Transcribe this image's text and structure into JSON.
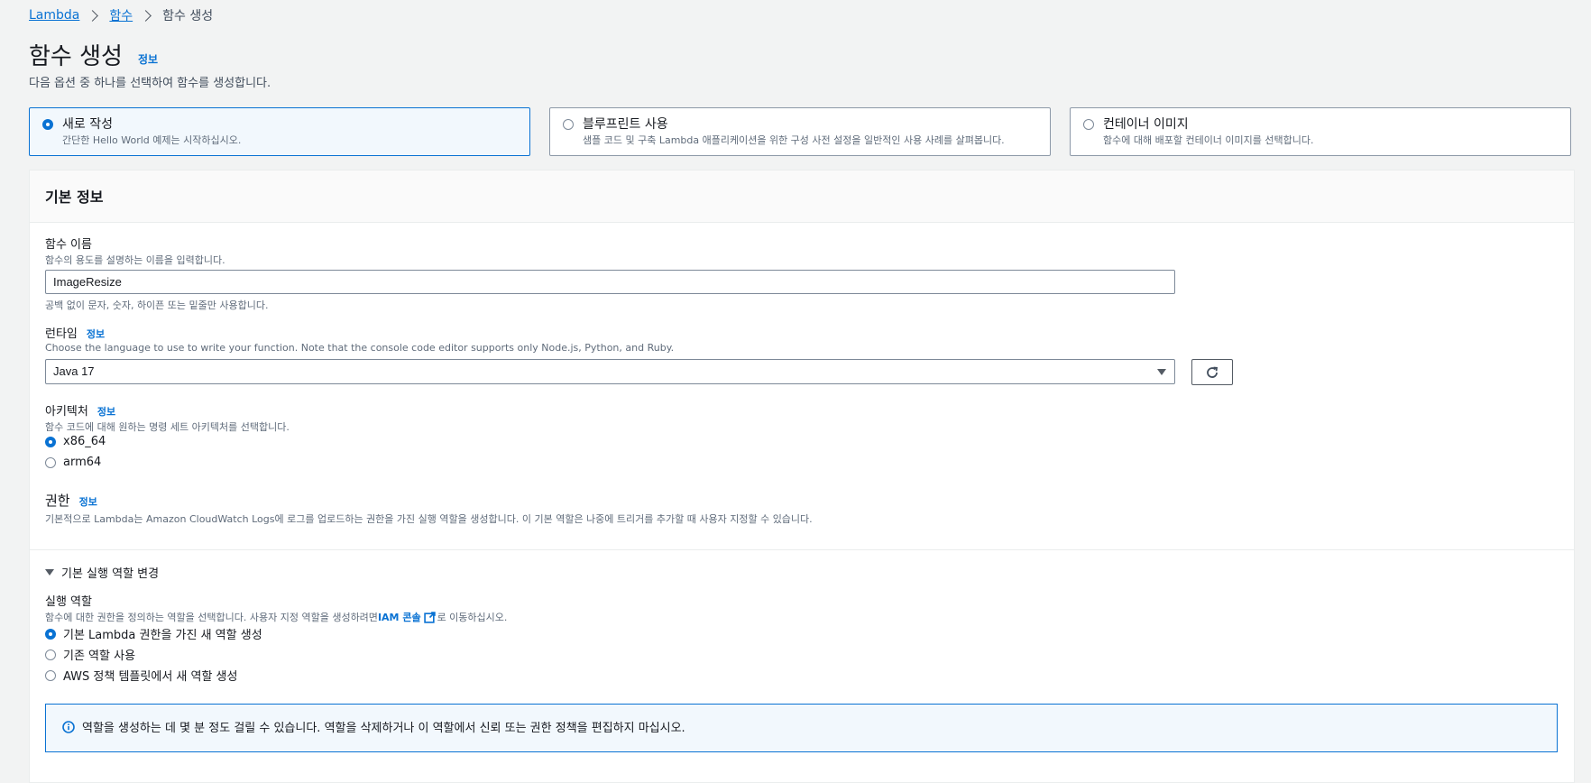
{
  "breadcrumb": {
    "items": [
      {
        "label": "Lambda"
      },
      {
        "label": "함수"
      },
      {
        "label": "함수 생성"
      }
    ]
  },
  "header": {
    "title": "함수 생성",
    "info_link": "정보",
    "subtitle": "다음 옵션 중 하나를 선택하여 함수를 생성합니다."
  },
  "creation_options": [
    {
      "title": "새로 작성",
      "description": "간단한 Hello World 예제는 시작하십시오.",
      "selected": true
    },
    {
      "title": "블루프린트 사용",
      "description": "샘플 코드 및 구축 Lambda 애플리케이션을 위한 구성 사전 설정을 일반적인 사용 사례를 살펴봅니다.",
      "selected": false
    },
    {
      "title": "컨테이너 이미지",
      "description": "함수에 대해 배포할 컨테이너 이미지를 선택합니다.",
      "selected": false
    }
  ],
  "basic_info": {
    "title": "기본 정보",
    "function_name": {
      "label": "함수 이름",
      "description": "함수의 용도를 설명하는 이름을 입력합니다.",
      "value": "ImageResize",
      "constraint": "공백 없이 문자, 숫자, 하이픈 또는 밑줄만 사용합니다."
    },
    "runtime": {
      "label": "런타임",
      "info_link": "정보",
      "description": "Choose the language to use to write your function. Note that the console code editor supports only Node.js, Python, and Ruby.",
      "selected": "Java 17"
    },
    "architecture": {
      "label": "아키텍처",
      "info_link": "정보",
      "description": "함수 코드에 대해 원하는 명령 세트 아키텍처를 선택합니다.",
      "options": [
        {
          "label": "x86_64",
          "selected": true
        },
        {
          "label": "arm64",
          "selected": false
        }
      ]
    },
    "permissions": {
      "title": "권한",
      "info_link": "정보",
      "description": "기본적으로 Lambda는 Amazon CloudWatch Logs에 로그를 업로드하는 권한을 가진 실행 역할을 생성합니다. 이 기본 역할은 나중에 트리거를 추가할 때 사용자 지정할 수 있습니다."
    },
    "execution_role_expander": {
      "label": "기본 실행 역할 변경"
    },
    "execution_role": {
      "label": "실행 역할",
      "description_before": "함수에 대한 권한을 정의하는 역할을 선택합니다. 사용자 지정 역할을 생성하려면 ",
      "link_text": "IAM 콘솔",
      "description_after": "로 이동하십시오.",
      "options": [
        {
          "label": "기본 Lambda 권한을 가진 새 역할 생성",
          "selected": true
        },
        {
          "label": "기존 역할 사용",
          "selected": false
        },
        {
          "label": "AWS 정책 템플릿에서 새 역할 생성",
          "selected": false
        }
      ]
    },
    "alert": {
      "text": "역할을 생성하는 데 몇 분 정도 걸릴 수 있습니다. 역할을 삭제하거나 이 역할에서 신뢰 또는 권한 정책을 편집하지 마십시오."
    }
  },
  "colors": {
    "accent": "#0972d3",
    "background": "#f2f3f3"
  }
}
